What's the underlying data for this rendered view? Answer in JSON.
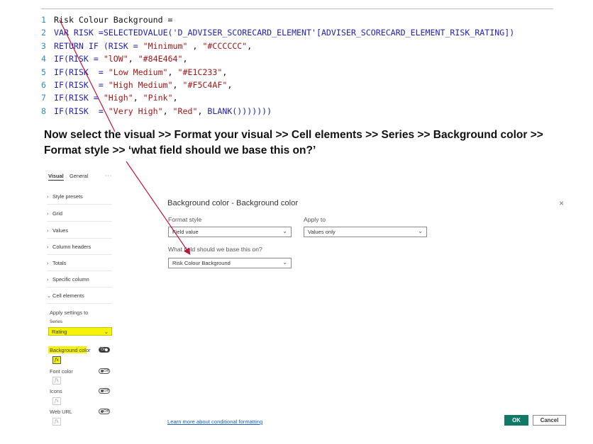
{
  "code": {
    "lines": [
      {
        "num": "1",
        "tokens": [
          {
            "t": "Risk Colour Background =",
            "c": "plain"
          }
        ]
      },
      {
        "num": "2",
        "tokens": [
          {
            "t": "VAR RISK =",
            "c": "kw"
          },
          {
            "t": "SELECTEDVALUE(",
            "c": "fn"
          },
          {
            "t": "'D_ADVISER_SCORECARD_ELEMENT'[ADVISER_SCORECARD_ELEMENT_RISK_RATING])",
            "c": "kw"
          }
        ]
      },
      {
        "num": "3",
        "tokens": [
          {
            "t": "RETURN IF ",
            "c": "kw"
          },
          {
            "t": "(RISK = ",
            "c": "kw"
          },
          {
            "t": "\"Minimum\"",
            "c": "str"
          },
          {
            "t": " , ",
            "c": "plain"
          },
          {
            "t": "\"#CCCCCC\"",
            "c": "str"
          },
          {
            "t": ",",
            "c": "plain"
          }
        ]
      },
      {
        "num": "4",
        "tokens": [
          {
            "t": "IF(RISK = ",
            "c": "kw"
          },
          {
            "t": "\"lOW\"",
            "c": "str"
          },
          {
            "t": ", ",
            "c": "plain"
          },
          {
            "t": "\"#84E464\"",
            "c": "str"
          },
          {
            "t": ",",
            "c": "plain"
          }
        ]
      },
      {
        "num": "5",
        "tokens": [
          {
            "t": "IF(RISK  = ",
            "c": "kw"
          },
          {
            "t": "\"Low Medium\"",
            "c": "str"
          },
          {
            "t": ", ",
            "c": "plain"
          },
          {
            "t": "\"#E1C233\"",
            "c": "str"
          },
          {
            "t": ",",
            "c": "plain"
          }
        ]
      },
      {
        "num": "6",
        "tokens": [
          {
            "t": "IF(RISK  = ",
            "c": "kw"
          },
          {
            "t": "\"High Medium\"",
            "c": "str"
          },
          {
            "t": ", ",
            "c": "plain"
          },
          {
            "t": "\"#F5C4AF\"",
            "c": "str"
          },
          {
            "t": ",",
            "c": "plain"
          }
        ]
      },
      {
        "num": "7",
        "tokens": [
          {
            "t": "IF(RISK = ",
            "c": "kw"
          },
          {
            "t": "\"High\"",
            "c": "str"
          },
          {
            "t": ", ",
            "c": "plain"
          },
          {
            "t": "\"Pink\"",
            "c": "str"
          },
          {
            "t": ",",
            "c": "plain"
          }
        ]
      },
      {
        "num": "8",
        "tokens": [
          {
            "t": "IF(RISK  = ",
            "c": "kw"
          },
          {
            "t": "\"Very High\"",
            "c": "str"
          },
          {
            "t": ", ",
            "c": "plain"
          },
          {
            "t": "\"Red\"",
            "c": "str"
          },
          {
            "t": ", ",
            "c": "plain"
          },
          {
            "t": "BLANK()))))))",
            "c": "fn"
          }
        ]
      }
    ]
  },
  "instruction": "Now select the visual >> Format your visual >> Cell elements >> Series >> Background color >> Format style >> ‘what field should we base this on?’",
  "pane": {
    "tab_visual": "Visual",
    "tab_general": "General",
    "more": "···",
    "sections": [
      "Style presets",
      "Grid",
      "Values",
      "Column headers",
      "Totals",
      "Specific column"
    ],
    "cell_elements": "Cell elements",
    "apply_settings_to": "Apply settings to",
    "series_label": "Series",
    "series_value": "Rating",
    "options": [
      {
        "label": "Background color",
        "state": "On"
      },
      {
        "label": "Font color",
        "state": "Off"
      },
      {
        "label": "Icons",
        "state": "Off"
      },
      {
        "label": "Web URL",
        "state": "Off"
      }
    ],
    "fx": "fx"
  },
  "dialog": {
    "title": "Background color - Background color",
    "close": "×",
    "format_style_label": "Format style",
    "format_style_value": "Field value",
    "apply_to_label": "Apply to",
    "apply_to_value": "Values only",
    "base_field_label": "What field should we base this on?",
    "base_field_value": "Risk Colour Background",
    "learn_more": "Learn more about conditional formatting",
    "ok": "OK",
    "cancel": "Cancel"
  },
  "colors": {
    "highlight": "#f4f10a",
    "ok_button": "#117865",
    "arrow": "#c0143c"
  }
}
